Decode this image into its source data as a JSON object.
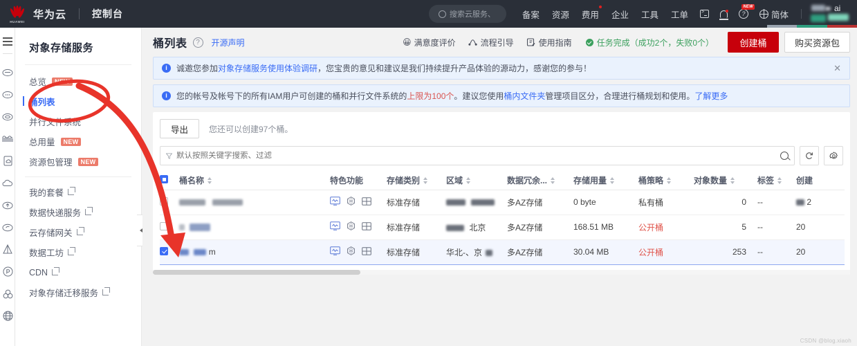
{
  "topnav": {
    "brand": "华为云",
    "console": "控制台",
    "search_placeholder": "搜索云服务、",
    "items": [
      {
        "label": "备案",
        "dot": false
      },
      {
        "label": "资源",
        "dot": false
      },
      {
        "label": "费用",
        "dot": true
      },
      {
        "label": "企业",
        "dot": false
      },
      {
        "label": "工具",
        "dot": false
      },
      {
        "label": "工单",
        "dot": false
      }
    ],
    "icons": [
      "cloudshell-icon",
      "bell-icon",
      "help-icon"
    ],
    "help_badge": "NEW",
    "lang": "简体",
    "ai_label": "ai"
  },
  "rail": {
    "menu_label": "菜单",
    "icons": [
      "cloud-storage-icon",
      "cloud-dots-icon",
      "cloud-obs-icon",
      "wave-icon",
      "doc-cloud-icon",
      "cloud-plain-icon",
      "cloud-up-icon",
      "cloud-check-icon",
      "pyramid-icon",
      "p-circle-icon",
      "cluster-icon",
      "globe-w-icon"
    ]
  },
  "sidebar": {
    "title": "对象存储服务",
    "items": [
      {
        "label": "总览",
        "badge": "NEW",
        "active": false,
        "external": false
      },
      {
        "label": "桶列表",
        "badge": "",
        "active": true,
        "external": false
      },
      {
        "label": "并行文件系统",
        "badge": "",
        "active": false,
        "external": false
      },
      {
        "label": "总用量",
        "badge": "NEW",
        "active": false,
        "external": false
      },
      {
        "label": "资源包管理",
        "badge": "NEW",
        "active": false,
        "external": false
      }
    ],
    "items2": [
      {
        "label": "我的套餐",
        "external": true
      },
      {
        "label": "数据快递服务",
        "external": true
      },
      {
        "label": "云存储网关",
        "external": true
      },
      {
        "label": "数据工坊",
        "external": true
      },
      {
        "label": "CDN",
        "external": true
      },
      {
        "label": "对象存储迁移服务",
        "external": true
      }
    ]
  },
  "page": {
    "title": "桶列表",
    "help_icon": "?",
    "open_source_link": "开源声明",
    "satisfaction": "满意度评价",
    "process_guide": "流程引导",
    "user_guide": "使用指南",
    "task_status": "任务完成（成功2个，失败0个）",
    "create_bucket": "创建桶",
    "buy_package": "购买资源包"
  },
  "alerts": [
    {
      "text_before": "诚邀您参加",
      "link": "对象存储服务使用体验调研",
      "text_after": "，您宝贵的意见和建议是我们持续提升产品体验的源动力，感谢您的参与！",
      "closable": true,
      "close_label": "✕"
    },
    {
      "text_before": "您的帐号及帐号下的所有IAM用户可创建的桶和并行文件系统的",
      "danger": "上限为100个",
      "text_mid": "。建议您使用",
      "link2": "桶内文件夹",
      "text_after": "管理项目区分，合理进行桶规划和使用。",
      "more_link": "了解更多",
      "closable": false
    }
  ],
  "toolbar": {
    "export_label": "导出",
    "quota_text": "您还可以创建97个桶。",
    "search_placeholder": "默认按照关键字搜索、过滤",
    "refresh_icon": "refresh-icon",
    "settings_icon": "gear-icon"
  },
  "table": {
    "columns": [
      {
        "label": "桶名称",
        "sortable": true
      },
      {
        "label": "特色功能",
        "sortable": false
      },
      {
        "label": "存储类别",
        "sortable": true
      },
      {
        "label": "区域",
        "sortable": true
      },
      {
        "label": "数据冗余...",
        "sortable": true
      },
      {
        "label": "存储用量",
        "sortable": true
      },
      {
        "label": "桶策略",
        "sortable": true
      },
      {
        "label": "对象数量",
        "sortable": true
      },
      {
        "label": "标签",
        "sortable": true
      },
      {
        "label": "创建",
        "sortable": false
      }
    ],
    "rows": [
      {
        "selected": false,
        "name": "",
        "name_redacted": true,
        "features": [
          "monitor-icon",
          "snowflake-icon",
          "table-icon"
        ],
        "storage_class": "标准存储",
        "region": "",
        "region_redacted": true,
        "redundancy": "多AZ存储",
        "usage": "0 byte",
        "policy": "私有桶",
        "policy_public": false,
        "objects": "0",
        "tag": "--",
        "created": "2"
      },
      {
        "selected": false,
        "name": "",
        "name_redacted": true,
        "features": [
          "monitor-icon",
          "snowflake-icon",
          "table-icon"
        ],
        "storage_class": "标准存储",
        "region": "北京",
        "region_redacted": true,
        "redundancy": "多AZ存储",
        "usage": "168.51 MB",
        "policy": "公开桶",
        "policy_public": true,
        "objects": "5",
        "tag": "--",
        "created": "20"
      },
      {
        "selected": true,
        "name": "m",
        "name_redacted": true,
        "features": [
          "monitor-icon",
          "snowflake-icon",
          "table-icon"
        ],
        "storage_class": "标准存储",
        "region": "华北-、京",
        "region_redacted": true,
        "redundancy": "多AZ存储",
        "usage": "30.04 MB",
        "policy": "公开桶",
        "policy_public": true,
        "objects": "253",
        "tag": "--",
        "created": "20"
      }
    ]
  },
  "watermark": "CSDN @blog.xiaoh",
  "colors": {
    "brand_red": "#c7000b",
    "link_blue": "#3a6cf5",
    "success_green": "#3ca05e",
    "public_red": "#e0544b",
    "annotation_red": "#e8342a"
  }
}
